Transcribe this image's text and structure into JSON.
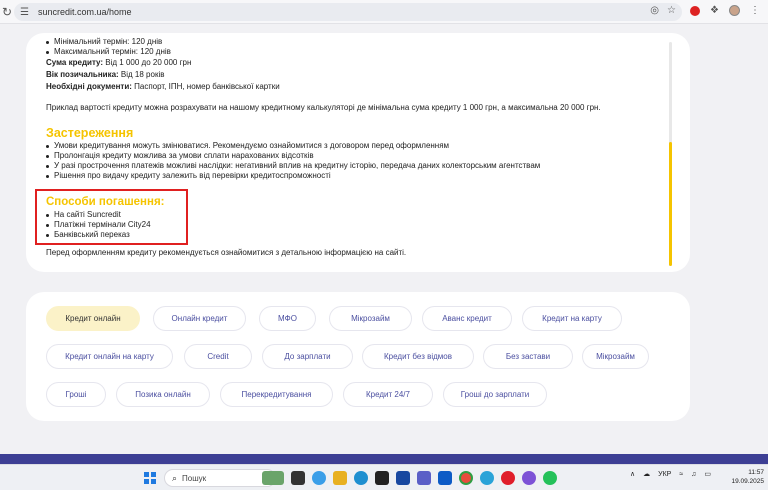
{
  "browser": {
    "url": "suncredit.com.ua/home"
  },
  "content": {
    "top_items": [
      "Мінімальний термін: 120 днів",
      "Максимальний термін: 120 днів"
    ],
    "loan_sum_label": "Сума кредиту:",
    "loan_sum_value": " Від 1 000 до 20 000 грн",
    "age_label": "Вік позичальника:",
    "age_value": " Від 18 років",
    "docs_label": "Необхідні документи:",
    "docs_value": " Паспорт, ІПН, номер банківської картки",
    "example": "Приклад вартості кредиту можна розрахувати на нашому кредитному калькуляторі де мінімальна сума кредиту 1 000 грн, а максимальна 20 000 грн.",
    "warnings_title": "Застереження",
    "warnings": [
      "Умови кредитування можуть змінюватися. Рекомендуємо ознайомитися з договором перед оформленням",
      "Пролонгація кредиту можлива за умови сплати нарахованих відсотків",
      "У разі прострочення платежів можливі наслідки: негативний вплив на кредитну історію, передача даних колекторським агентствам",
      "Рішення про видачу кредиту залежить від перевірки кредитоспроможності"
    ],
    "repay_title": "Способи погашення:",
    "repay": [
      "На сайті Suncredit",
      "Платіжні термінали City24",
      "Банківський переказ"
    ],
    "note": "Перед оформленням кредиту рекомендується ознайомитися з детальною інформацією на сайті."
  },
  "tags": [
    "Кредит онлайн",
    "Онлайн кредит",
    "МФО",
    "Мікрозайм",
    "Аванс кредит",
    "Кредит на карту",
    "Кредит онлайн на карту",
    "Credit",
    "До зарплати",
    "Кредит без відмов",
    "Без застави",
    "Мікрозайм",
    "Гроші",
    "Позика онлайн",
    "Перекредитування",
    "Кредит 24/7",
    "Гроші до зарплати"
  ],
  "taskbar": {
    "search_placeholder": "Пошук",
    "lang": "УКР",
    "time": "11:57",
    "date": "19.09.2025"
  },
  "colors": {
    "accent_yellow": "#f5c400",
    "tag_text": "#4b4fa0",
    "footer_band": "#3d3f94",
    "highlight_red": "#e02020"
  },
  "icons": [
    "reload-icon",
    "tune-icon",
    "eye-off-icon",
    "star-icon",
    "extension-icon",
    "puzzle-icon",
    "avatar",
    "more-icon",
    "windows-icon",
    "search-icon"
  ]
}
